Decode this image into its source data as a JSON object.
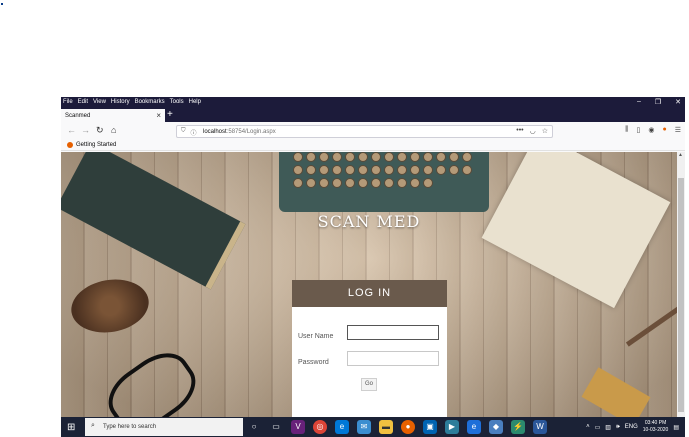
{
  "browser": {
    "menu": [
      "File",
      "Edit",
      "View",
      "History",
      "Bookmarks",
      "Tools",
      "Help"
    ],
    "window_controls": [
      "minimize-icon",
      "restore-icon",
      "close-icon"
    ],
    "tab": {
      "title": "Scanmed",
      "close": "×",
      "new_tab": "+"
    },
    "url": {
      "host": "localhost",
      "path": ":58754/Login.aspx"
    },
    "bookmark": "Getting Started"
  },
  "app": {
    "brand": "SCAN MED",
    "login_title": "LOG IN",
    "username_label": "User Name",
    "password_label": "Password",
    "go_label": "Go"
  },
  "taskbar": {
    "search_placeholder": "Type here to search",
    "language": "ENG",
    "time": "03:40 PM",
    "date": "10-03-2020"
  }
}
